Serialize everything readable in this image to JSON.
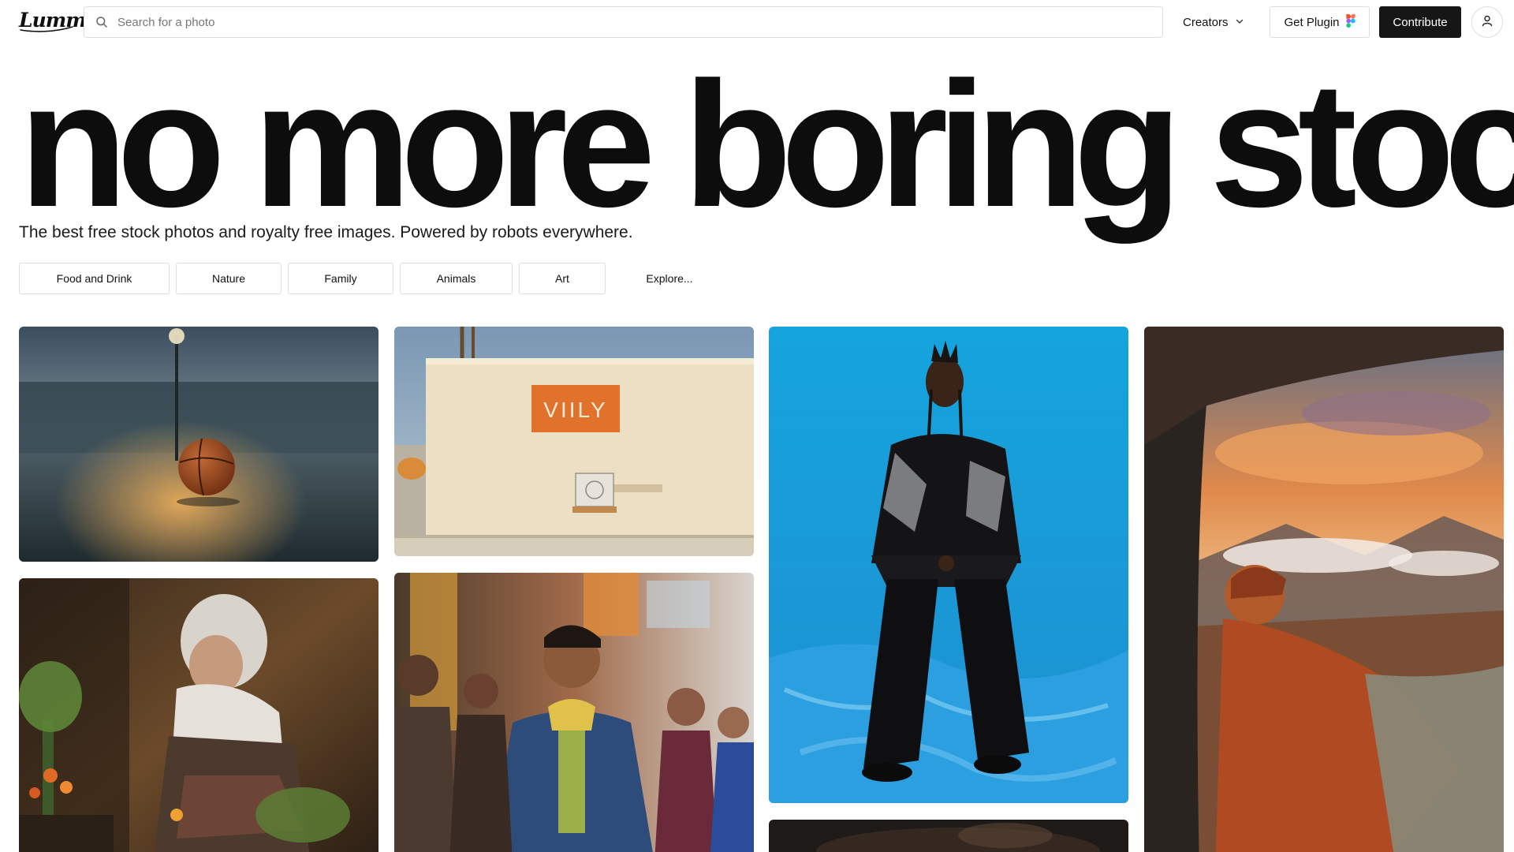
{
  "header": {
    "logo_text": "Lummi",
    "search_placeholder": "Search for a photo",
    "creators_label": "Creators",
    "plugin_label": "Get Plugin",
    "contribute_label": "Contribute"
  },
  "hero": {
    "headline": "no more boring stock",
    "tagline": "The best free stock photos and royalty free images. Powered by robots everywhere."
  },
  "categories": [
    "Food and Drink",
    "Nature",
    "Family",
    "Animals",
    "Art"
  ],
  "explore_label": "Explore...",
  "photos": [
    {
      "name": "basketball",
      "sign": ""
    },
    {
      "name": "wall-sign",
      "sign": "VIILY"
    },
    {
      "name": "man-blue-backdrop",
      "sign": ""
    },
    {
      "name": "van-mountain-view",
      "sign": ""
    },
    {
      "name": "woman-gardening",
      "sign": ""
    },
    {
      "name": "street-crowd",
      "sign": ""
    },
    {
      "name": "dark-photo",
      "sign": ""
    }
  ],
  "colors": {
    "accent_dark": "#161616",
    "border": "#dedede",
    "sky_blue": "#1aa3d8"
  }
}
